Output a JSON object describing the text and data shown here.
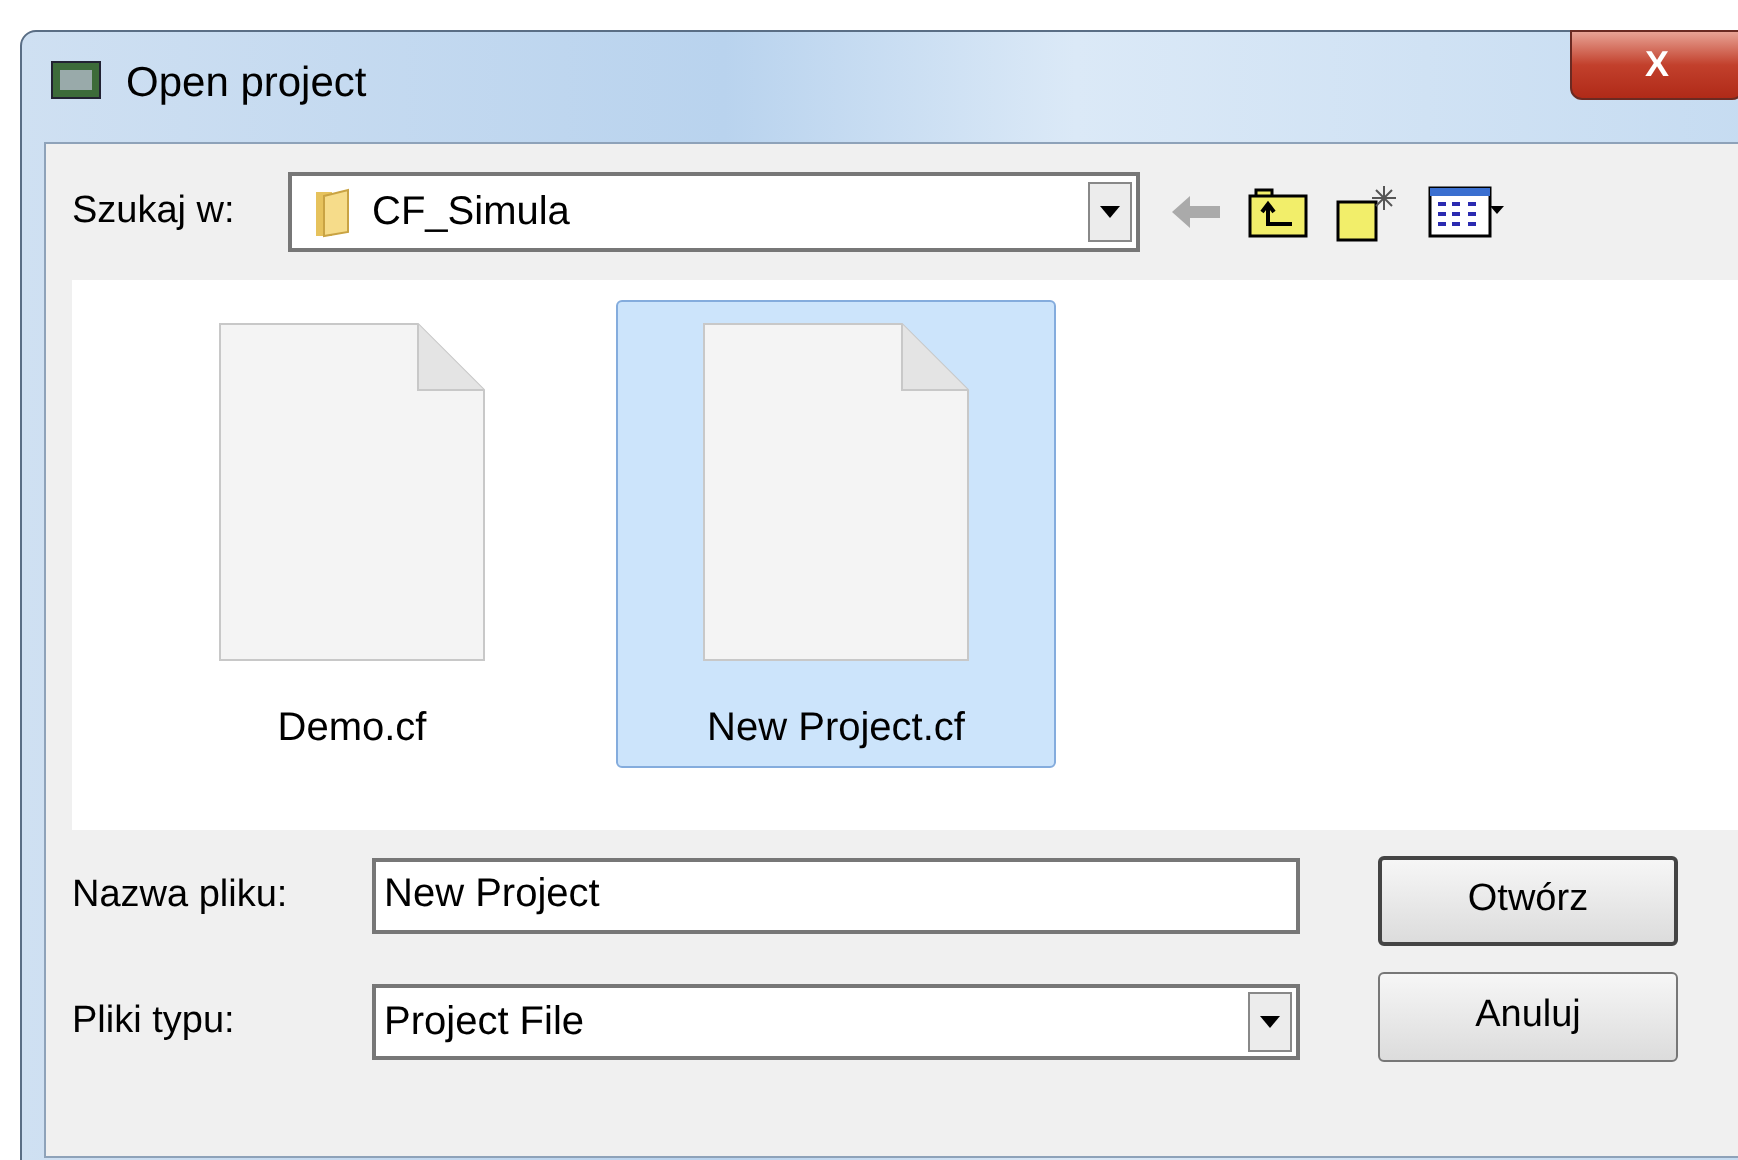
{
  "window": {
    "title": "Open project",
    "close": "X"
  },
  "look_in": {
    "label": "Szukaj w:",
    "value": "CF_Simula"
  },
  "files": [
    {
      "name": "Demo.cf",
      "selected": false
    },
    {
      "name": "New Project.cf",
      "selected": true
    }
  ],
  "file_name": {
    "label": "Nazwa pliku:",
    "value": "New Project"
  },
  "file_type": {
    "label": "Pliki typu:",
    "value": "Project File"
  },
  "buttons": [
    "Otwórz",
    "Anuluj"
  ]
}
